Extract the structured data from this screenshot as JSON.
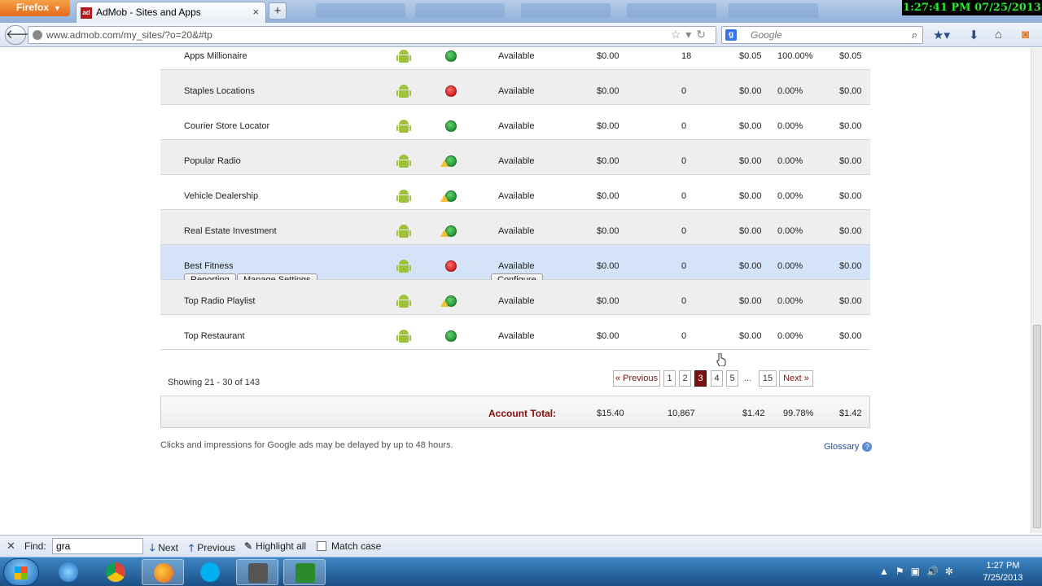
{
  "browser": {
    "menu_button": "Firefox",
    "tab_title": "AdMob - Sites and Apps",
    "tab_favicon_text": "ad",
    "new_tab": "+",
    "url": "www.admob.com/my_sites/?o=20&#tp",
    "search_placeholder": "Google",
    "recording_clock": "1:27:41 PM 07/25/2013"
  },
  "sites": [
    {
      "name": "Apps Millionaire",
      "status": "green",
      "warning": false,
      "availability": "Available",
      "revenue": "$0.00",
      "impressions": "18",
      "ecpm": "$0.05",
      "fill_rate": "100.00%",
      "est_revenue": "$0.05"
    },
    {
      "name": "Staples Locations",
      "status": "red",
      "warning": false,
      "availability": "Available",
      "revenue": "$0.00",
      "impressions": "0",
      "ecpm": "$0.00",
      "fill_rate": "0.00%",
      "est_revenue": "$0.00"
    },
    {
      "name": "Courier Store Locator",
      "status": "green",
      "warning": false,
      "availability": "Available",
      "revenue": "$0.00",
      "impressions": "0",
      "ecpm": "$0.00",
      "fill_rate": "0.00%",
      "est_revenue": "$0.00"
    },
    {
      "name": "Popular Radio",
      "status": "green",
      "warning": true,
      "availability": "Available",
      "revenue": "$0.00",
      "impressions": "0",
      "ecpm": "$0.00",
      "fill_rate": "0.00%",
      "est_revenue": "$0.00"
    },
    {
      "name": "Vehicle Dealership",
      "status": "green",
      "warning": true,
      "availability": "Available",
      "revenue": "$0.00",
      "impressions": "0",
      "ecpm": "$0.00",
      "fill_rate": "0.00%",
      "est_revenue": "$0.00"
    },
    {
      "name": "Real Estate Investment",
      "status": "green",
      "warning": true,
      "availability": "Available",
      "revenue": "$0.00",
      "impressions": "0",
      "ecpm": "$0.00",
      "fill_rate": "0.00%",
      "est_revenue": "$0.00"
    },
    {
      "name": "Best Fitness",
      "status": "red",
      "warning": false,
      "availability": "Available",
      "revenue": "$0.00",
      "impressions": "0",
      "ecpm": "$0.00",
      "fill_rate": "0.00%",
      "est_revenue": "$0.00"
    },
    {
      "name": "Top Radio Playlist",
      "status": "green",
      "warning": true,
      "availability": "Available",
      "revenue": "$0.00",
      "impressions": "0",
      "ecpm": "$0.00",
      "fill_rate": "0.00%",
      "est_revenue": "$0.00"
    },
    {
      "name": "Top Restaurant",
      "status": "green",
      "warning": false,
      "availability": "Available",
      "revenue": "$0.00",
      "impressions": "0",
      "ecpm": "$0.00",
      "fill_rate": "0.00%",
      "est_revenue": "$0.00"
    }
  ],
  "row_actions": {
    "reporting": "Reporting",
    "manage_settings": "Manage Settings",
    "configure": "Configure"
  },
  "pagination": {
    "showing": "Showing 21 - 30 of 143",
    "previous": "« Previous",
    "pages": [
      "1",
      "2",
      "3",
      "4",
      "5"
    ],
    "current_page": "3",
    "ellipsis": "...",
    "last_page": "15",
    "next": "Next »"
  },
  "totals": {
    "label": "Account Total:",
    "revenue": "$15.40",
    "impressions": "10,867",
    "ecpm": "$1.42",
    "fill_rate": "99.78%",
    "est_revenue": "$1.42"
  },
  "footer": {
    "disclaimer": "Clicks and impressions for Google ads may be delayed by up to 48 hours.",
    "glossary": "Glossary",
    "glossary_icon": "?"
  },
  "findbar": {
    "close": "✕",
    "label": "Find:",
    "value": "gra",
    "next": "Next",
    "previous": "Previous",
    "highlight_all": "Highlight all",
    "match_case": "Match case"
  },
  "taskbar": {
    "time": "1:27 PM",
    "date": "7/25/2013"
  },
  "colors": {
    "android": "#9fc13a",
    "status_green": "#0e7e24",
    "status_red": "#c00000",
    "active_page": "#7a1212",
    "hover_row": "#d5e3f9"
  }
}
